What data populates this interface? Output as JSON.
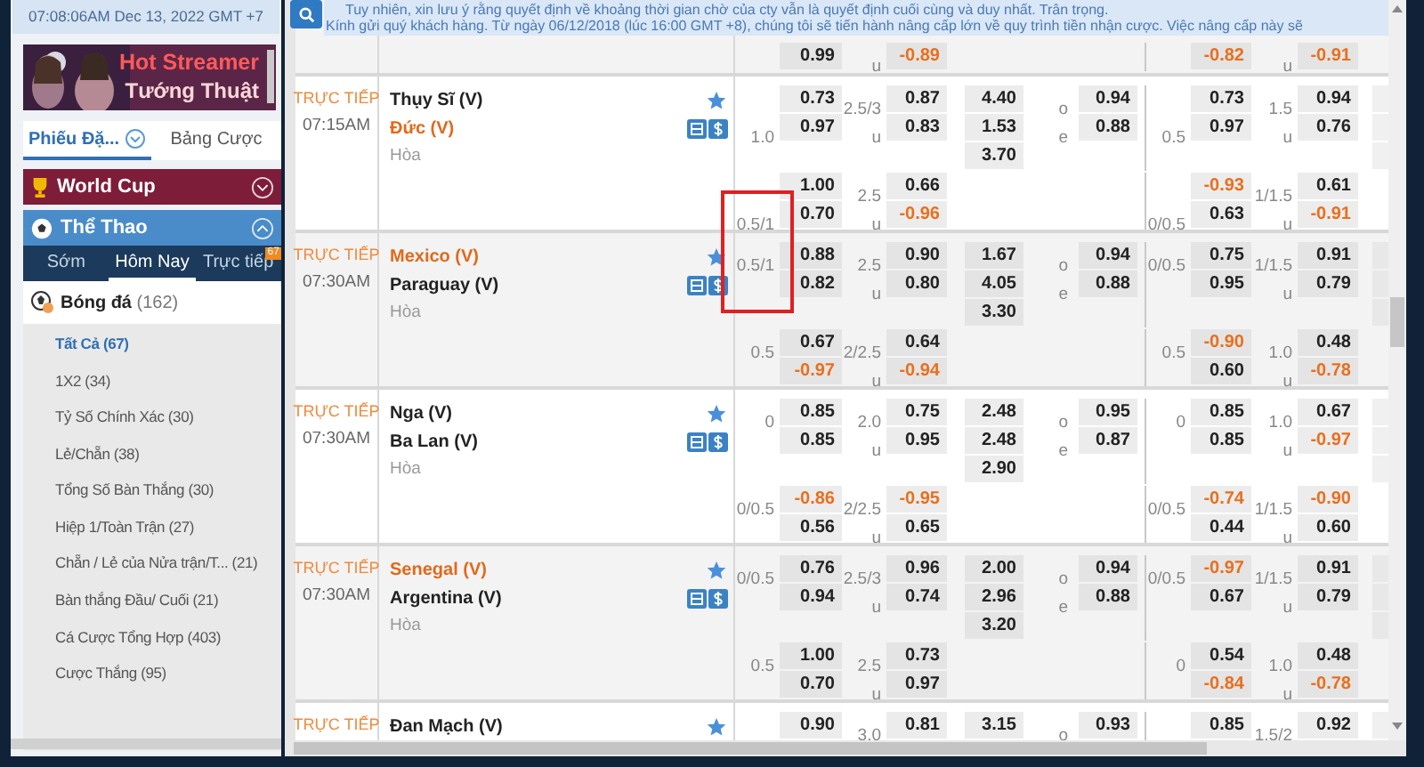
{
  "sidebar": {
    "datetime": "07:08:06AM Dec 13, 2022 GMT +7",
    "banner": {
      "line1": "Hot Streamer",
      "line2": "Tướng Thuật"
    },
    "tabs": [
      {
        "label": "Phiếu Đặ...",
        "selected": true
      },
      {
        "label": "Bảng Cược",
        "selected": false
      }
    ],
    "world_cup": {
      "label": "World Cup",
      "expanded": false
    },
    "sports": {
      "label": "Thể Thao",
      "expanded": true
    },
    "sport_tabs": [
      {
        "label": "Sớm",
        "selected": false
      },
      {
        "label": "Hôm Nay",
        "selected": true
      },
      {
        "label": "Trực tiếp",
        "selected": false,
        "badge": "67"
      }
    ],
    "sport": {
      "label": "Bóng đá",
      "count": "(162)"
    },
    "markets": [
      {
        "label": "Tất Cả (67)",
        "selected": true
      },
      {
        "label": "1X2 (34)",
        "selected": false
      },
      {
        "label": "Tỷ Số Chính Xác (30)",
        "selected": false
      },
      {
        "label": "Lẻ/Chẵn (38)",
        "selected": false
      },
      {
        "label": "Tổng Số Bàn Thắng (30)",
        "selected": false
      },
      {
        "label": "Hiệp 1/Toàn Trận (27)",
        "selected": false
      },
      {
        "label": "Chẵn / Lẻ của Nửa trận/T... (21)",
        "selected": false
      },
      {
        "label": "Bàn thắng Đầu/ Cuối (21)",
        "selected": false
      },
      {
        "label": "Cá Cược Tổng Hợp (403)",
        "selected": false
      },
      {
        "label": "Cược Thắng (95)",
        "selected": false
      }
    ]
  },
  "notice": {
    "lines": [
      "Tuy nhiên, xin lưu ý rằng quyết định về khoảng thời gian chờ của cty vẫn là quyết định cuối cùng và duy nhất. Trân trọng.",
      "Kính gửi quý khách hàng. Từ ngày 06/12/2018 (lúc 16:00 GMT +8), chúng tôi sẽ tiến hành nâng cấp lớn về quy trình tiền nhận cược. Việc nâng cấp này sẽ"
    ]
  },
  "matches": [
    {
      "second": [
        {
          "hdp": "0.99",
          "ou_line": "u",
          "ou": "-0.89",
          "h1_hdp": "-0.82",
          "h1_ou_line": "u",
          "h1_ou": "-0.91"
        }
      ]
    },
    {
      "status": "TRỰC TIẾP",
      "time": "07:15AM",
      "teams": [
        {
          "name": "Thụy Sĩ (V)",
          "highlight": false
        },
        {
          "name": "Đức (V)",
          "highlight": true
        }
      ],
      "draw": "Hòa",
      "main": [
        {
          "hdp": "0.73",
          "ou_line": "2.5/3",
          "ou": "0.87",
          "x12": "4.40",
          "oe_label": "o",
          "oe": "0.94",
          "h1_hdp": "0.73",
          "h1_ou_line": "1.5",
          "h1_ou": "0.94"
        },
        {
          "hdp_line": "1.0",
          "hdp": "0.97",
          "ou_line": "u",
          "ou": "0.83",
          "x12": "1.53",
          "oe_label": "e",
          "oe": "0.88",
          "h1_hdp_line": "0.5",
          "h1_hdp": "0.97",
          "h1_ou_line": "u",
          "h1_ou": "0.76"
        },
        {
          "x12": "3.70"
        }
      ],
      "second": [
        {
          "hdp": "1.00",
          "ou_line": "2.5",
          "ou": "0.66",
          "h1_hdp": "-0.93",
          "h1_ou_line": "1/1.5",
          "h1_ou": "0.61"
        },
        {
          "hdp_line": "0.5/1",
          "hdp": "0.70",
          "ou_line": "u",
          "ou": "-0.96",
          "h1_hdp_line": "0/0.5",
          "h1_hdp": "0.63",
          "h1_ou_line": "u",
          "h1_ou": "-0.91"
        }
      ]
    },
    {
      "status": "TRỰC TIẾP",
      "time": "07:30AM",
      "teams": [
        {
          "name": "Mexico (V)",
          "highlight": true
        },
        {
          "name": "Paraguay (V)",
          "highlight": false
        }
      ],
      "draw": "Hòa",
      "main": [
        {
          "hdp_line": "0.5/1",
          "hdp": "0.88",
          "ou_line": "2.5",
          "ou": "0.90",
          "x12": "1.67",
          "oe_label": "o",
          "oe": "0.94",
          "h1_hdp_line": "0/0.5",
          "h1_hdp": "0.75",
          "h1_ou_line": "1/1.5",
          "h1_ou": "0.91"
        },
        {
          "hdp": "0.82",
          "ou_line": "u",
          "ou": "0.80",
          "x12": "4.05",
          "oe_label": "e",
          "oe": "0.88",
          "h1_hdp": "0.95",
          "h1_ou_line": "u",
          "h1_ou": "0.79"
        },
        {
          "x12": "3.30"
        }
      ],
      "second": [
        {
          "hdp_line": "0.5",
          "hdp": "0.67",
          "ou_line": "2/2.5",
          "ou": "0.64",
          "h1_hdp_line": "0.5",
          "h1_hdp": "-0.90",
          "h1_ou_line": "1.0",
          "h1_ou": "0.48"
        },
        {
          "hdp": "-0.97",
          "ou_line": "u",
          "ou": "-0.94",
          "h1_hdp": "0.60",
          "h1_ou_line": "u",
          "h1_ou": "-0.78"
        }
      ]
    },
    {
      "status": "TRỰC TIẾP",
      "time": "07:30AM",
      "teams": [
        {
          "name": "Nga (V)",
          "highlight": false
        },
        {
          "name": "Ba Lan (V)",
          "highlight": false
        }
      ],
      "draw": "Hòa",
      "main": [
        {
          "hdp_line": "0",
          "hdp": "0.85",
          "ou_line": "2.0",
          "ou": "0.75",
          "x12": "2.48",
          "oe_label": "o",
          "oe": "0.95",
          "h1_hdp_line": "0",
          "h1_hdp": "0.85",
          "h1_ou_line": "1.0",
          "h1_ou": "0.67"
        },
        {
          "hdp": "0.85",
          "ou_line": "u",
          "ou": "0.95",
          "x12": "2.48",
          "oe_label": "e",
          "oe": "0.87",
          "h1_hdp": "0.85",
          "h1_ou_line": "u",
          "h1_ou": "-0.97"
        },
        {
          "x12": "2.90"
        }
      ],
      "second": [
        {
          "hdp_line": "0/0.5",
          "hdp": "-0.86",
          "ou_line": "2/2.5",
          "ou": "-0.95",
          "h1_hdp_line": "0/0.5",
          "h1_hdp": "-0.74",
          "h1_ou_line": "1/1.5",
          "h1_ou": "-0.90"
        },
        {
          "hdp": "0.56",
          "ou_line": "u",
          "ou": "0.65",
          "h1_hdp": "0.44",
          "h1_ou_line": "u",
          "h1_ou": "0.60"
        }
      ]
    },
    {
      "status": "TRỰC TIẾP",
      "time": "07:30AM",
      "teams": [
        {
          "name": "Senegal (V)",
          "highlight": true
        },
        {
          "name": "Argentina (V)",
          "highlight": false
        }
      ],
      "draw": "Hòa",
      "main": [
        {
          "hdp_line": "0/0.5",
          "hdp": "0.76",
          "ou_line": "2.5/3",
          "ou": "0.96",
          "x12": "2.00",
          "oe_label": "o",
          "oe": "0.94",
          "h1_hdp_line": "0/0.5",
          "h1_hdp": "-0.97",
          "h1_ou_line": "1/1.5",
          "h1_ou": "0.91"
        },
        {
          "hdp": "0.94",
          "ou_line": "u",
          "ou": "0.74",
          "x12": "2.96",
          "oe_label": "e",
          "oe": "0.88",
          "h1_hdp": "0.67",
          "h1_ou_line": "u",
          "h1_ou": "0.79"
        },
        {
          "x12": "3.20"
        }
      ],
      "second": [
        {
          "hdp_line": "0.5",
          "hdp": "1.00",
          "ou_line": "2.5",
          "ou": "0.73",
          "h1_hdp_line": "0",
          "h1_hdp": "0.54",
          "h1_ou_line": "1.0",
          "h1_ou": "0.48"
        },
        {
          "hdp": "0.70",
          "ou_line": "u",
          "ou": "0.97",
          "h1_hdp": "-0.84",
          "h1_ou_line": "u",
          "h1_ou": "-0.78"
        }
      ]
    },
    {
      "status": "TRỰC TIẾP",
      "teams": [
        {
          "name": "Đan Mạch (V)",
          "highlight": false
        }
      ],
      "main": [
        {
          "hdp": "0.90",
          "ou_line": "3.0",
          "ou": "0.81",
          "x12": "3.15",
          "oe_label": "o",
          "oe": "0.93",
          "h1_hdp": "0.85",
          "h1_ou_line": "1.5/2",
          "h1_ou": "0.92"
        }
      ]
    }
  ]
}
